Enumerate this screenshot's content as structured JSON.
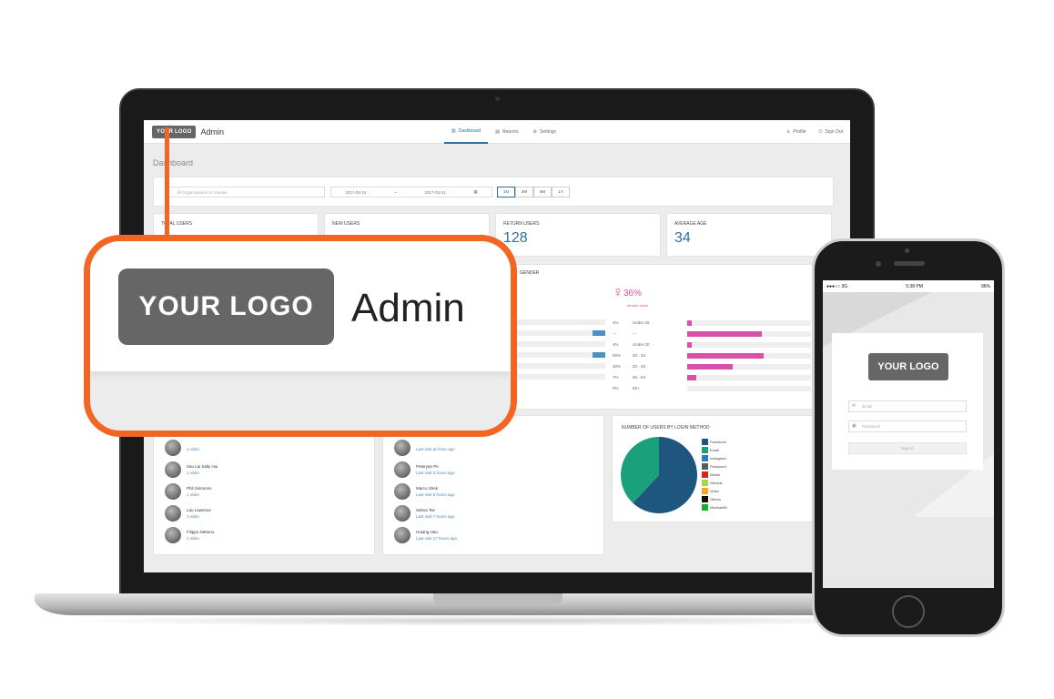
{
  "app": {
    "logo": "YOUR LOGO",
    "admin_label": "Admin"
  },
  "nav": {
    "dashboard": "Dashboard",
    "reports": "Reports",
    "settings": "Settings",
    "profile": "Profile",
    "sign_out": "Sign Out"
  },
  "page_title": "Dashboard",
  "filters": {
    "search_placeholder": "All Organizations or Venues",
    "date_from": "2017-03-24",
    "date_sep": "~",
    "date_to": "2017-03-31",
    "ranges": [
      "1M",
      "3M",
      "6M",
      "1Y"
    ],
    "active_range": "1M"
  },
  "stats": [
    {
      "label": "TOTAL USERS",
      "value": ""
    },
    {
      "label": "NEW USERS",
      "value": ""
    },
    {
      "label": "RETURN USERS",
      "value": "128"
    },
    {
      "label": "AVERAGE AGE",
      "value": "34"
    }
  ],
  "gender": {
    "title": "GENDER",
    "female_pct": "36%",
    "female_label": "female users",
    "male_bar_levels": [
      0,
      0.1,
      0,
      0.1,
      0,
      0
    ],
    "age_rows": [
      {
        "pct": "4%",
        "label": "Under 20",
        "level": 0.04
      },
      {
        "pct": "---",
        "label": "---",
        "level": 0.6
      },
      {
        "pct": "4%",
        "label": "Under 20",
        "level": 0.04
      },
      {
        "pct": "56%",
        "label": "20 - 34",
        "level": 0.62
      },
      {
        "pct": "30%",
        "label": "20 - 40",
        "level": 0.37
      },
      {
        "pct": "7%",
        "label": "55 - 64",
        "level": 0.07
      },
      {
        "pct": "0%",
        "label": "65+",
        "level": 0
      }
    ]
  },
  "top_users": [
    {
      "name": "",
      "meta": "1 visits"
    },
    {
      "name": "Sau Lai Sally Hui",
      "meta": "1 visits"
    },
    {
      "name": "Phil Simmons",
      "meta": "1 visits"
    },
    {
      "name": "Lau Lawence",
      "meta": "1 visits"
    },
    {
      "name": "Filippo Nettuno",
      "meta": "1 visits"
    }
  ],
  "recent_users": [
    {
      "name": "",
      "meta": "Last visit an hour ago"
    },
    {
      "name": "Peteryan Pe",
      "meta": "Last visit 3 hours ago"
    },
    {
      "name": "Marco Shek",
      "meta": "Last visit 6 hours ago"
    },
    {
      "name": "Selma Tse",
      "meta": "Last visit 7 hours ago"
    },
    {
      "name": "Hoiang Hau",
      "meta": "Last visit 17 hours ago"
    }
  ],
  "login_method": {
    "title": "NUMBER OF USERS BY LOGIN METHOD",
    "legend": [
      {
        "label": "Facebook",
        "color": "#1f5680"
      },
      {
        "label": "Email",
        "color": "#1aa07a"
      },
      {
        "label": "Instagram",
        "color": "#2f7bbf"
      },
      {
        "label": "Password",
        "color": "#5b5b5b"
      },
      {
        "label": "Weibo",
        "color": "#e02020"
      },
      {
        "label": "Wechat",
        "color": "#a8d44a"
      },
      {
        "label": "Video",
        "color": "#f5a623"
      },
      {
        "label": "Others",
        "color": "#111111"
      },
      {
        "label": "WechatAD",
        "color": "#19b021"
      }
    ]
  },
  "chart_data": {
    "type": "pie",
    "title": "NUMBER OF USERS BY LOGIN METHOD",
    "slices": [
      {
        "label": "Facebook",
        "value": 62
      },
      {
        "label": "Email",
        "value": 38
      }
    ]
  },
  "phone": {
    "carrier": "●●●○○ 3G",
    "time": "5:38 PM",
    "battery": "96%",
    "logo": "YOUR LOGO",
    "email_placeholder": "Email",
    "password_placeholder": "Password",
    "sign_in": "Sign in"
  },
  "callout": {
    "logo": "YOUR LOGO",
    "admin": "Admin"
  }
}
